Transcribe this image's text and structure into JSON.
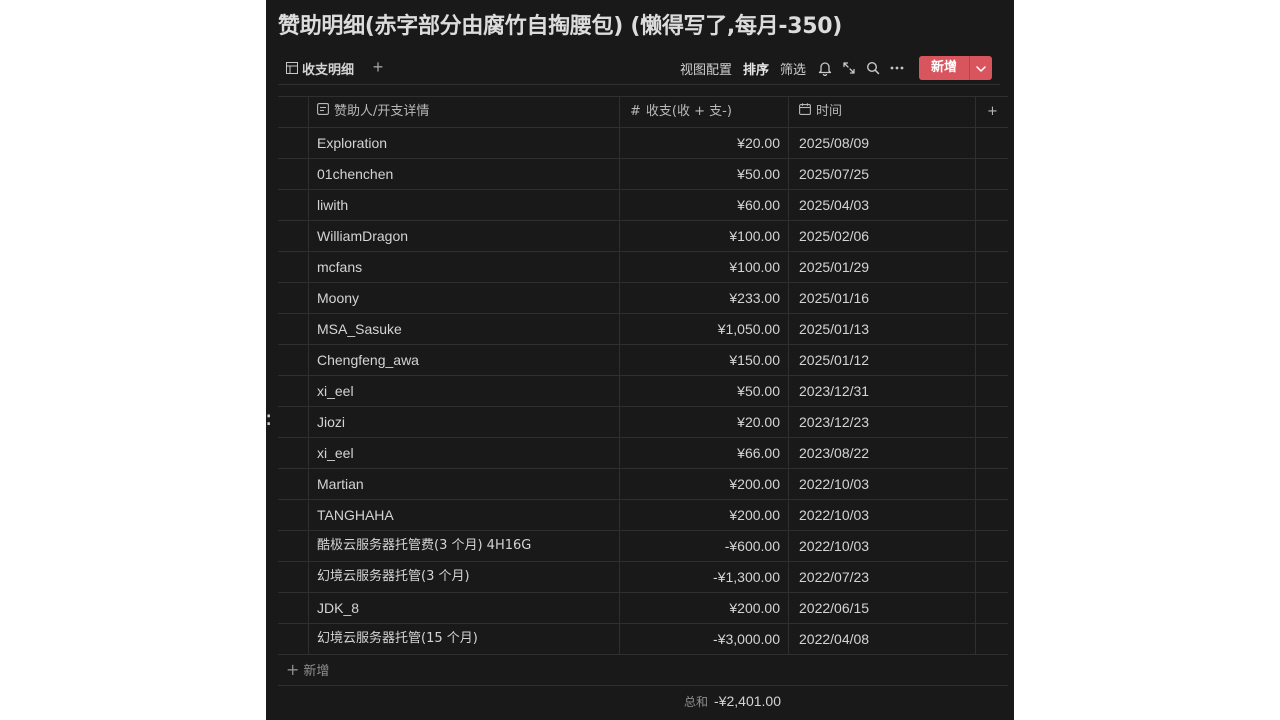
{
  "page": {
    "title": "赞助明细(赤字部分由腐竹自掏腰包) (懒得写了,每月-350)"
  },
  "toolbar": {
    "tab_label": "收支明细",
    "add_view": "+",
    "view_config": "视图配置",
    "sort": "排序",
    "filter": "筛选",
    "new_button": "新增"
  },
  "table": {
    "columns": {
      "name": "赞助人/开支详情",
      "amount": "收支(收 + 支-)",
      "date": "时间",
      "add": "+"
    },
    "rows": [
      {
        "name": "Exploration",
        "amount": "¥20.00",
        "date": "2025/08/09"
      },
      {
        "name": "01chenchen",
        "amount": "¥50.00",
        "date": "2025/07/25"
      },
      {
        "name": "liwith",
        "amount": "¥60.00",
        "date": "2025/04/03"
      },
      {
        "name": "WilliamDragon",
        "amount": "¥100.00",
        "date": "2025/02/06"
      },
      {
        "name": "mcfans",
        "amount": "¥100.00",
        "date": "2025/01/29"
      },
      {
        "name": "Moony",
        "amount": "¥233.00",
        "date": "2025/01/16"
      },
      {
        "name": "MSA_Sasuke",
        "amount": "¥1,050.00",
        "date": "2025/01/13"
      },
      {
        "name": "Chengfeng_awa",
        "amount": "¥150.00",
        "date": "2025/01/12"
      },
      {
        "name": "xi_eel",
        "amount": "¥50.00",
        "date": "2023/12/31"
      },
      {
        "name": "Jiozi",
        "amount": "¥20.00",
        "date": "2023/12/23"
      },
      {
        "name": "xi_eel",
        "amount": "¥66.00",
        "date": "2023/08/22"
      },
      {
        "name": "Martian",
        "amount": "¥200.00",
        "date": "2022/10/03"
      },
      {
        "name": "TANGHAHA",
        "amount": "¥200.00",
        "date": "2022/10/03"
      },
      {
        "name": "酷极云服务器托管费(3 个月) 4H16G",
        "amount": "-¥600.00",
        "date": "2022/10/03"
      },
      {
        "name": "幻境云服务器托管(3 个月)",
        "amount": "-¥1,300.00",
        "date": "2022/07/23"
      },
      {
        "name": "JDK_8",
        "amount": "¥200.00",
        "date": "2022/06/15"
      },
      {
        "name": "幻境云服务器托管(15 个月)",
        "amount": "-¥3,000.00",
        "date": "2022/04/08"
      }
    ],
    "add_row_plus": "+",
    "add_row_label": "新增",
    "summary_label": "总和",
    "summary_value": "-¥2,401.00"
  },
  "colors": {
    "background": "#191919",
    "accent": "#d9555e",
    "text": "#d4d4d4",
    "border": "#2f2f2f"
  },
  "icons": [
    "table-view-icon",
    "bell-icon",
    "expand-icon",
    "search-icon",
    "more-icon",
    "chevron-down-icon",
    "text-field-icon",
    "number-field-icon",
    "calendar-icon",
    "drag-handle-icon"
  ]
}
